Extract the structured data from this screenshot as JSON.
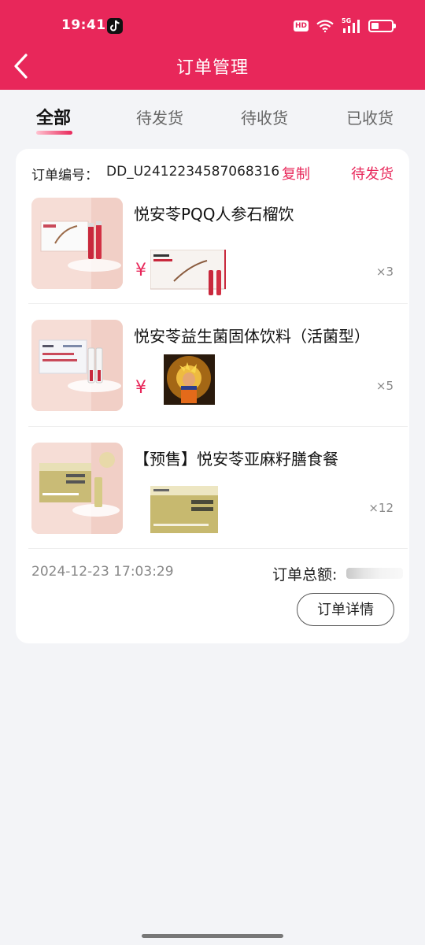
{
  "status_bar": {
    "time": "19:41",
    "hd_badge": "HD",
    "signal": "5G"
  },
  "header": {
    "title": "订单管理",
    "back_icon": "chevron-left-icon",
    "color": "#e8275a"
  },
  "tabs": [
    {
      "label": "全部",
      "active": true
    },
    {
      "label": "待发货",
      "active": false
    },
    {
      "label": "待收货",
      "active": false
    },
    {
      "label": "已收货",
      "active": false
    }
  ],
  "order": {
    "number_label": "订单编号：",
    "number_value": "DD_U2412234587068316",
    "copy_label": "复制",
    "status": "待发货",
    "items": [
      {
        "title": "悦安苓PQQ人参石榴饮",
        "price_symbol": "¥",
        "quantity": "×3"
      },
      {
        "title": "悦安苓益生菌固体饮料（活菌型）",
        "price_symbol": "¥",
        "quantity": "×5"
      },
      {
        "title": "【预售】悦安苓亚麻籽膳食餐",
        "price_symbol": "",
        "quantity": "×12"
      }
    ],
    "time": "2024-12-23 17:03:29",
    "total_label": "订单总额:",
    "detail_button": "订单详情"
  },
  "colors": {
    "accent": "#e8275a",
    "background": "#f3f4f7"
  }
}
